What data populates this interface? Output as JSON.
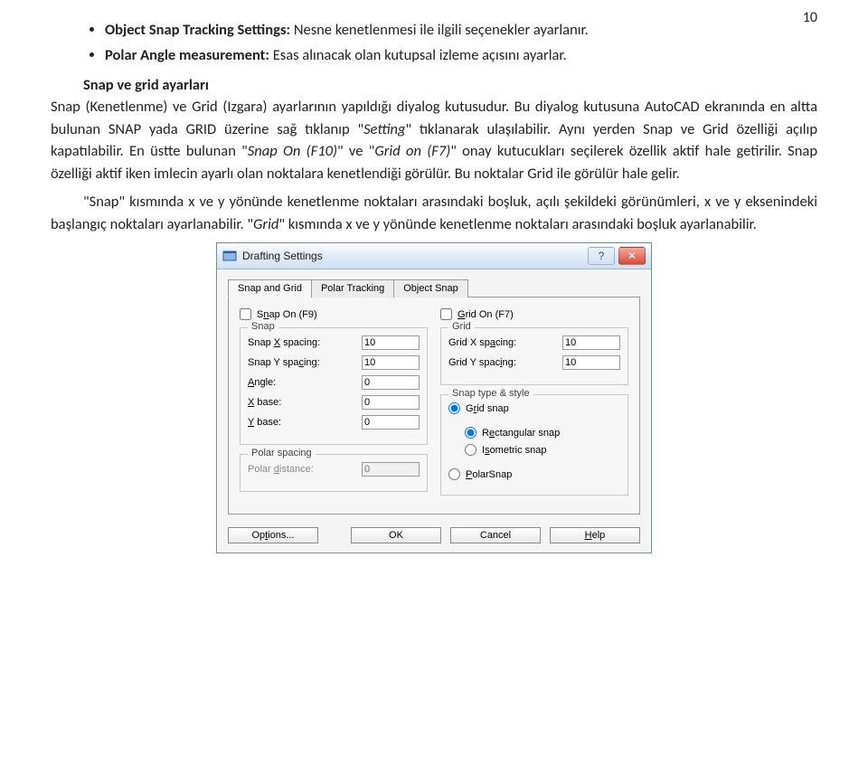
{
  "page_number": "10",
  "bullet_items": [
    {
      "label": "Object Snap Tracking Settings:",
      "desc": "Nesne kenetlenmesi ile ilgili seçenekler ayarlanır."
    },
    {
      "label": "Polar Angle measurement:",
      "desc": "Esas alınacak olan kutupsal izleme açısını ayarlar."
    }
  ],
  "subheading": "Snap ve grid ayarları",
  "para1_pre": "Snap (Kenetlenme) ve Grid (Izgara) ayarlarının yapıldığı diyalog kutusudur. Bu diyalog kutusuna AutoCAD ekranında en altta bulunan SNAP yada GRID üzerine sağ tıklanıp \"",
  "para1_set": "Setting",
  "para1_mid": "\" tıklanarak ulaşılabilir. Aynı yerden Snap ve Grid özelliği açılıp kapatılabilir. En üstte bulunan \"",
  "para1_snapon": "Snap On (F10)",
  "para1_mid2": "\" ve \"",
  "para1_gridon": "Grid on (F7)",
  "para1_post": "\" onay kutucukları seçilerek özellik aktif hale getirilir. Snap özelliği aktif iken imlecin ayarlı olan noktalara kenetlendiği görülür. Bu noktalar Grid ile görülür hale gelir.",
  "para2_pre": "\"Snap\" kısmında x ve y yönünde kenetlenme noktaları arasındaki boşluk, açılı şekildeki görünümleri, x ve y eksenindeki başlangıç noktaları ayarlanabilir. \"",
  "para2_grid": "Grid",
  "para2_post": "\" kısmında x ve y yönünde kenetlenme noktaları arasındaki boşluk ayarlanabilir.",
  "dialog": {
    "title": "Drafting Settings",
    "tabs": {
      "snap_grid": "Snap and Grid",
      "polar": "Polar Tracking",
      "osnap": "Object Snap"
    },
    "snap_on": "Snap On (F9)",
    "grid_on": "Grid On (F7)",
    "snap_group": "Snap",
    "grid_group": "Grid",
    "snap_x_label": "Snap X spacing:",
    "snap_y_label": "Snap Y spacing:",
    "angle_label": "Angle:",
    "xbase_label": "X base:",
    "ybase_label": "Y base:",
    "grid_x_label": "Grid X spacing:",
    "grid_y_label": "Grid Y spacing:",
    "polar_group": "Polar spacing",
    "polar_dist_label": "Polar distance:",
    "snaptype_group": "Snap type & style",
    "grid_snap": "Grid snap",
    "rect_snap": "Rectangular snap",
    "iso_snap": "Isometric snap",
    "polar_snap": "PolarSnap",
    "vals": {
      "snapx": "10",
      "snapy": "10",
      "angle": "0",
      "xbase": "0",
      "ybase": "0",
      "gridx": "10",
      "gridy": "10",
      "polard": "0"
    },
    "buttons": {
      "options": "Options...",
      "ok": "OK",
      "cancel": "Cancel",
      "help": "Help"
    }
  }
}
